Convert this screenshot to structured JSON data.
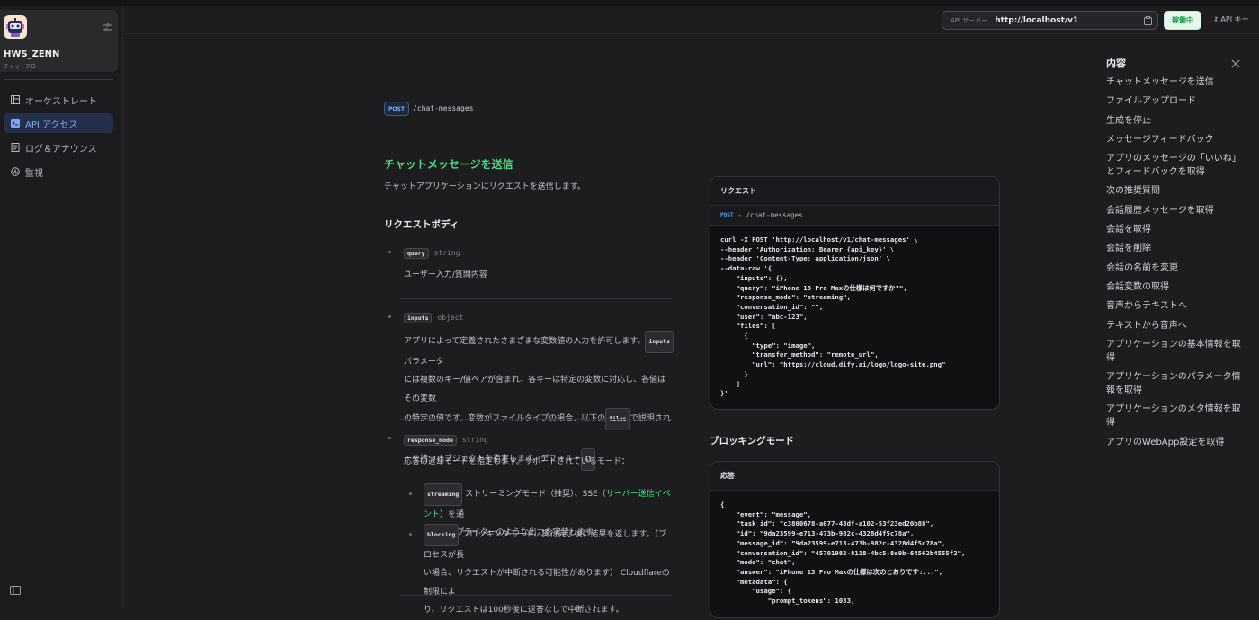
{
  "app": {
    "name": "HWS_ZENN",
    "subtitle": "チャットフロー"
  },
  "nav": [
    {
      "label": "オーケストレート",
      "icon": "layout-icon",
      "active": false
    },
    {
      "label": "API アクセス",
      "icon": "terminal-icon",
      "active": true
    },
    {
      "label": "ログ＆アナウンス",
      "icon": "document-icon",
      "active": false
    },
    {
      "label": "監視",
      "icon": "monitor-icon",
      "active": false
    }
  ],
  "topbar": {
    "api_server_label": "API サーバー",
    "api_server_url": "http://localhost/v1",
    "status": "稼働中",
    "api_key_label": "API キー"
  },
  "endpoint": {
    "method": "POST",
    "path": "/chat-messages"
  },
  "section": {
    "title": "チャットメッセージを送信",
    "description": "チャットアプリケーションにリクエストを送信します。"
  },
  "request_body": {
    "title": "リクエストボディ",
    "params": [
      {
        "name": "query",
        "type": "string",
        "lines": [
          "ユーザー入力/質問内容"
        ]
      },
      {
        "name": "inputs",
        "type": "object"
      },
      {
        "name": "response_mode",
        "type": "string",
        "lines": [
          "応答の返却モードを指定します。サポートされているモード："
        ]
      }
    ],
    "inputs_desc": {
      "l1_pre": "アプリによって定義されたさまざまな変数値の入力を許可します。",
      "code1": "inputs",
      "l1_post": "パラメータ",
      "l2": "には複数のキー/値ペアが含まれ、各キーは特定の変数に対応し、各値はその変数",
      "l3_pre": "の特定の値です。変数がファイルタイプの場合、以下の",
      "code2": "files",
      "l3_post": "で説明されているキ",
      "l4_pre": "ーを持つオブジェクトを指定します。デフォルト",
      "code3": "{}"
    },
    "modes": {
      "streaming_code": "streaming",
      "streaming_l1_pre": "ストリーミングモード（推奨）、SSE（",
      "streaming_link": "サーバー送信イベント",
      "streaming_l1_post": "）を通",
      "streaming_l2": "じてタイプライターのような出力を実装します。",
      "blocking_code": "blocking",
      "blocking_l1": "ブロッキングモード、実行完了後に結果を返します。（プロセスが長",
      "blocking_l2": "い場合、リクエストが中断される可能性があります） Cloudflareの制限によ",
      "blocking_l3": "り、リクエストは100秒後に返答なしで中断されます。"
    }
  },
  "request_panel": {
    "title": "リクエスト",
    "method": "POST",
    "path": "/chat-messages",
    "code": "curl -X POST 'http://localhost/v1/chat-messages' \\\n--header 'Authorization: Bearer {api_key}' \\\n--header 'Content-Type: application/json' \\\n--data-raw '{\n    \"inputs\": {},\n    \"query\": \"iPhone 13 Pro Maxの仕様は何ですか?\",\n    \"response_mode\": \"streaming\",\n    \"conversation_id\": \"\",\n    \"user\": \"abc-123\",\n    \"files\": [\n      {\n        \"type\": \"image\",\n        \"transfer_method\": \"remote_url\",\n        \"url\": \"https://cloud.dify.ai/logo/logo-site.png\"\n      }\n    ]\n}'"
  },
  "blocking_title": "ブロッキングモード",
  "response_panel": {
    "title": "応答",
    "code": "{\n    \"event\": \"message\",\n    \"task_id\": \"c3800678-a077-43df-a102-53f23ed20b88\",\n    \"id\": \"9da23599-e713-473b-982c-4328d4f5c78a\",\n    \"message_id\": \"9da23599-e713-473b-982c-4328d4f5c78a\",\n    \"conversation_id\": \"45701982-8118-4bc5-8e9b-64562b4555f2\",\n    \"mode\": \"chat\",\n    \"answer\": \"iPhone 13 Pro Maxの仕様は次のとおりです:...\",\n    \"metadata\": {\n        \"usage\": {\n            \"prompt_tokens\": 1033,"
  },
  "toc": {
    "title": "内容",
    "items": [
      "チャットメッセージを送信",
      "ファイルアップロード",
      "生成を停止",
      "メッセージフィードバック",
      "アプリのメッセージの「いいね」とフィードバックを取得",
      "次の推奨質問",
      "会話履歴メッセージを取得",
      "会話を取得",
      "会話を削除",
      "会話の名前を変更",
      "会話変数の取得",
      "音声からテキストへ",
      "テキストから音声へ",
      "アプリケーションの基本情報を取得",
      "アプリケーションのパラメータ情報を取得",
      "アプリケーションのメタ情報を取得",
      "アプリのWebApp設定を取得"
    ]
  }
}
